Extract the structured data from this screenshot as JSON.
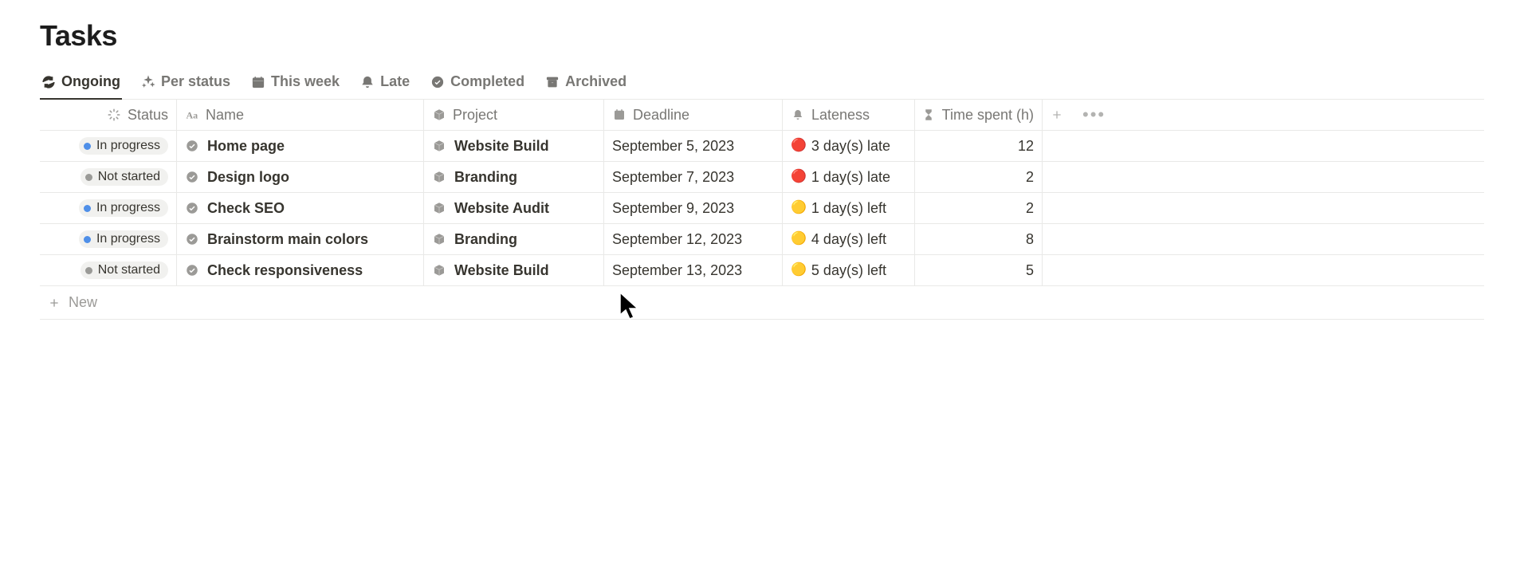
{
  "title": "Tasks",
  "tabs": [
    {
      "label": "Ongoing",
      "icon": "refresh"
    },
    {
      "label": "Per status",
      "icon": "sparkle"
    },
    {
      "label": "This week",
      "icon": "calendar"
    },
    {
      "label": "Late",
      "icon": "bell"
    },
    {
      "label": "Completed",
      "icon": "check-circle"
    },
    {
      "label": "Archived",
      "icon": "archive"
    }
  ],
  "activeTab": 0,
  "columns": {
    "status": "Status",
    "name": "Name",
    "project": "Project",
    "deadline": "Deadline",
    "lateness": "Lateness",
    "timespent": "Time spent (h)"
  },
  "rows": [
    {
      "status": {
        "label": "In progress",
        "dot": "blue"
      },
      "name": "Home page",
      "project": "Website Build",
      "deadline": "September 5, 2023",
      "lateness": {
        "emoji": "🔴",
        "text": "3 day(s) late"
      },
      "time": "12"
    },
    {
      "status": {
        "label": "Not started",
        "dot": "grey"
      },
      "name": "Design logo",
      "project": "Branding",
      "deadline": "September 7, 2023",
      "lateness": {
        "emoji": "🔴",
        "text": "1 day(s) late"
      },
      "time": "2"
    },
    {
      "status": {
        "label": "In progress",
        "dot": "blue"
      },
      "name": "Check SEO",
      "project": "Website Audit",
      "deadline": "September 9, 2023",
      "lateness": {
        "emoji": "🟡",
        "text": "1 day(s) left"
      },
      "time": "2"
    },
    {
      "status": {
        "label": "In progress",
        "dot": "blue"
      },
      "name": "Brainstorm main colors",
      "project": "Branding",
      "deadline": "September 12, 2023",
      "lateness": {
        "emoji": "🟡",
        "text": "4 day(s) left"
      },
      "time": "8"
    },
    {
      "status": {
        "label": "Not started",
        "dot": "grey"
      },
      "name": "Check responsiveness",
      "project": "Website Build",
      "deadline": "September 13, 2023",
      "lateness": {
        "emoji": "🟡",
        "text": "5 day(s) left"
      },
      "time": "5"
    }
  ],
  "newRow": "New"
}
